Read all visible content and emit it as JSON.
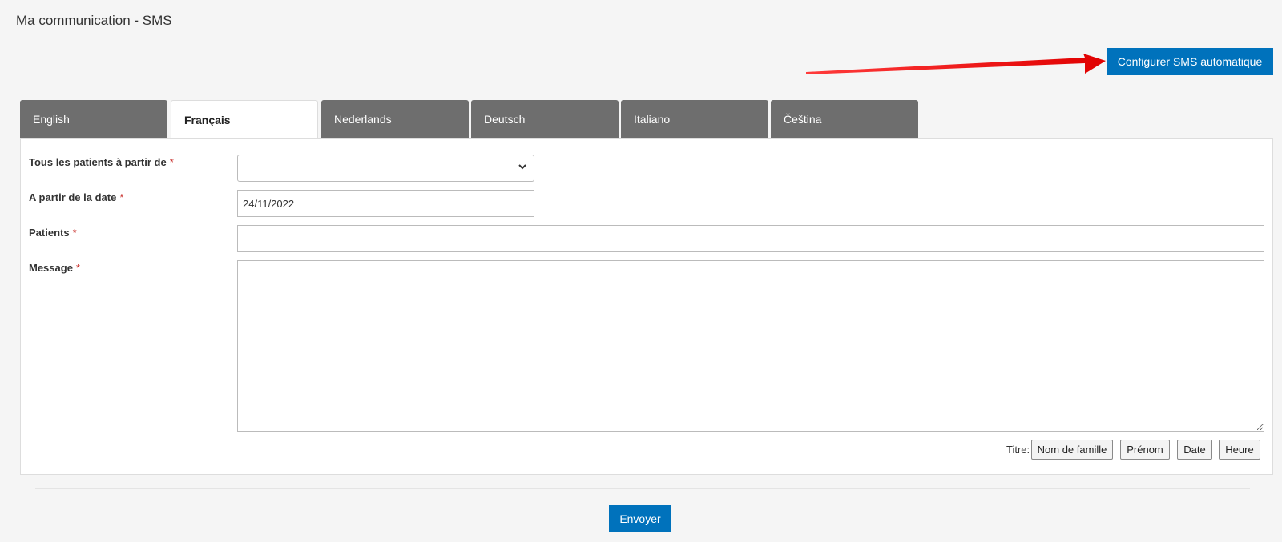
{
  "page": {
    "title": "Ma communication - SMS"
  },
  "header": {
    "config_button_label": "Configurer SMS automatique"
  },
  "tabs": [
    {
      "label": "English",
      "active": false
    },
    {
      "label": "Français",
      "active": true
    },
    {
      "label": "Nederlands",
      "active": false
    },
    {
      "label": "Deutsch",
      "active": false
    },
    {
      "label": "Italiano",
      "active": false
    },
    {
      "label": "Čeština",
      "active": false
    }
  ],
  "form": {
    "from_patients_label": "Tous les patients à partir de",
    "from_patients_value": "",
    "from_date_label": "A partir de la date",
    "from_date_value": "24/11/2022",
    "patients_label": "Patients",
    "patients_value": "",
    "message_label": "Message",
    "message_value": "",
    "required_marker": "*"
  },
  "placeholders": {
    "label": "Titre:",
    "buttons": [
      "Nom de famille",
      "Prénom",
      "Date",
      "Heure"
    ]
  },
  "footer": {
    "send_label": "Envoyer"
  },
  "colors": {
    "primary": "#0072bc",
    "tab_inactive": "#6e6e6e",
    "required": "#c9302c",
    "annotation_arrow": "#ff0000"
  },
  "icons": {
    "select_chevron": "chevron-down-icon",
    "annotation": "red-arrow-annotation"
  }
}
